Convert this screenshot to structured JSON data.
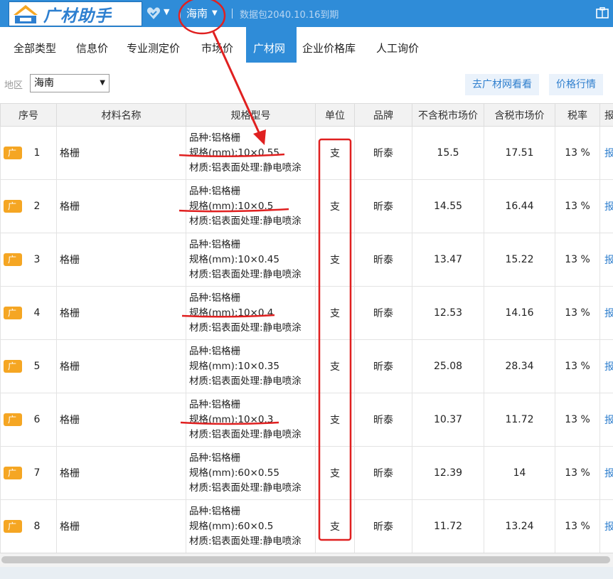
{
  "app": {
    "title": "广材助手",
    "region": "海南",
    "package_text": "数据包2040.10.16到期"
  },
  "tabs": [
    {
      "label": "全部类型"
    },
    {
      "label": "信息价"
    },
    {
      "label": "专业测定价"
    },
    {
      "label": "市场价"
    },
    {
      "label": "广材网",
      "active": true
    },
    {
      "label": "企业价格库"
    },
    {
      "label": "人工询价"
    }
  ],
  "filter": {
    "area_label": "地区",
    "area_value": "海南",
    "goto_button": "去广材网看看",
    "trend_button": "价格行情"
  },
  "table": {
    "headers": {
      "seq": "序号",
      "name": "材料名称",
      "spec": "规格型号",
      "unit": "单位",
      "brand": "品牌",
      "price_ex_tax": "不含税市场价",
      "price_inc_tax": "含税市场价",
      "tax": "税率",
      "report": "报"
    },
    "tag_char": "广",
    "rows": [
      {
        "seq": "1",
        "name": "格栅",
        "spec1": "品种:铝格栅",
        "spec2": "规格(mm):10×0.55",
        "spec3": "材质:铝表面处理:静电喷涂",
        "unit": "支",
        "brand": "昕泰",
        "price_ex": "15.5",
        "price_inc": "17.51",
        "tax": "13 %",
        "report": "报"
      },
      {
        "seq": "2",
        "name": "格栅",
        "spec1": "品种:铝格栅",
        "spec2": "规格(mm):10×0.5",
        "spec3": "材质:铝表面处理:静电喷涂",
        "unit": "支",
        "brand": "昕泰",
        "price_ex": "14.55",
        "price_inc": "16.44",
        "tax": "13 %",
        "report": "报"
      },
      {
        "seq": "3",
        "name": "格栅",
        "spec1": "品种:铝格栅",
        "spec2": "规格(mm):10×0.45",
        "spec3": "材质:铝表面处理:静电喷涂",
        "unit": "支",
        "brand": "昕泰",
        "price_ex": "13.47",
        "price_inc": "15.22",
        "tax": "13 %",
        "report": "报"
      },
      {
        "seq": "4",
        "name": "格栅",
        "spec1": "品种:铝格栅",
        "spec2": "规格(mm):10×0.4",
        "spec3": "材质:铝表面处理:静电喷涂",
        "unit": "支",
        "brand": "昕泰",
        "price_ex": "12.53",
        "price_inc": "14.16",
        "tax": "13 %",
        "report": "报"
      },
      {
        "seq": "5",
        "name": "格栅",
        "spec1": "品种:铝格栅",
        "spec2": "规格(mm):10×0.35",
        "spec3": "材质:铝表面处理:静电喷涂",
        "unit": "支",
        "brand": "昕泰",
        "price_ex": "25.08",
        "price_inc": "28.34",
        "tax": "13 %",
        "report": "报"
      },
      {
        "seq": "6",
        "name": "格栅",
        "spec1": "品种:铝格栅",
        "spec2": "规格(mm):10×0.3",
        "spec3": "材质:铝表面处理:静电喷涂",
        "unit": "支",
        "brand": "昕泰",
        "price_ex": "10.37",
        "price_inc": "11.72",
        "tax": "13 %",
        "report": "报"
      },
      {
        "seq": "7",
        "name": "格栅",
        "spec1": "品种:铝格栅",
        "spec2": "规格(mm):60×0.55",
        "spec3": "材质:铝表面处理:静电喷涂",
        "unit": "支",
        "brand": "昕泰",
        "price_ex": "12.39",
        "price_inc": "14",
        "tax": "13 %",
        "report": "报"
      },
      {
        "seq": "8",
        "name": "格栅",
        "spec1": "品种:铝格栅",
        "spec2": "规格(mm):60×0.5",
        "spec3": "材质:铝表面处理:静电喷涂",
        "unit": "支",
        "brand": "昕泰",
        "price_ex": "11.72",
        "price_inc": "13.24",
        "tax": "13 %",
        "report": "报"
      }
    ]
  },
  "icons": {
    "logo": "logo-icon",
    "favorite": "heart-icon",
    "window": "window-icon"
  },
  "colors": {
    "brand_blue": "#2f8cd8",
    "tag_orange": "#f5a623",
    "annotation_red": "#e02020",
    "link_blue": "#2f7fce"
  }
}
